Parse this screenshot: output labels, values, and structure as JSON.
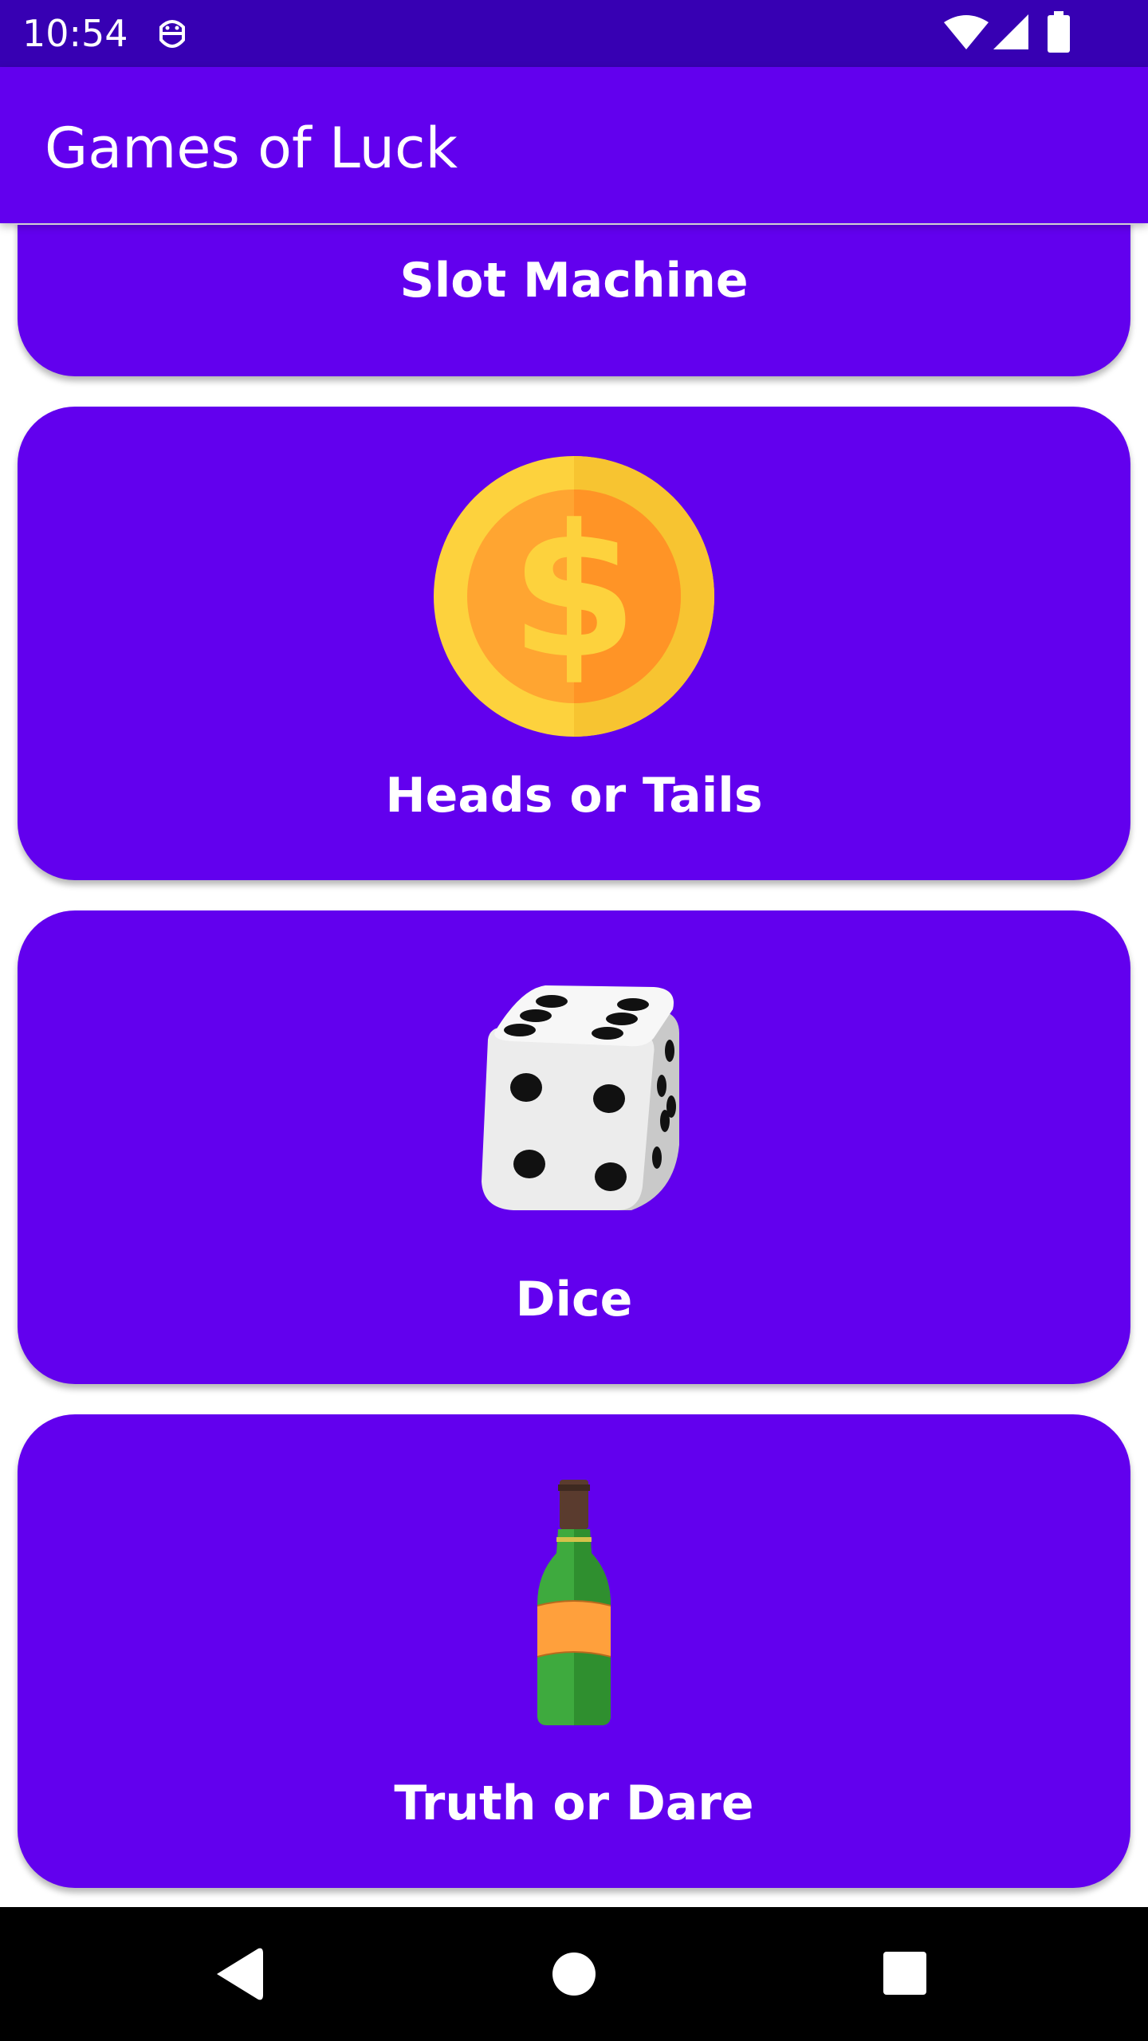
{
  "status_bar": {
    "time": "10:54",
    "icons": [
      "notification-face-icon",
      "wifi-icon",
      "cell-signal-icon",
      "battery-icon"
    ]
  },
  "app_bar": {
    "title": "Games of Luck"
  },
  "games": [
    {
      "label": "Slot Machine",
      "icon": "slot-machine-icon"
    },
    {
      "label": "Heads or Tails",
      "icon": "coin-icon"
    },
    {
      "label": "Dice",
      "icon": "dice-icon"
    },
    {
      "label": "Truth or Dare",
      "icon": "bottle-icon"
    }
  ],
  "nav_bar": {
    "buttons": [
      "back-icon",
      "home-icon",
      "recents-icon"
    ]
  },
  "colors": {
    "status_bar": "#3700b3",
    "primary": "#6200ee",
    "coin_outer": "#fdd23d",
    "coin_inner": "#ffa531",
    "bottle_green": "#3eaa3e",
    "bottle_label": "#ffa03c"
  }
}
